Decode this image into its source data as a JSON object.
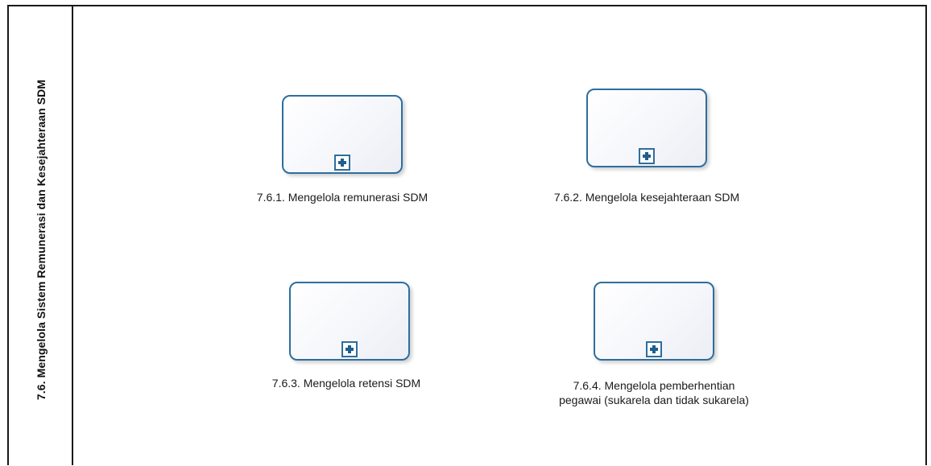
{
  "pool": {
    "title": "7.6. Mengelola Sistem Remunerasi dan Kesejahteraan SDM"
  },
  "tasks": [
    {
      "label": "7.6.1. Mengelola remunerasi SDM",
      "marker": "plus-icon"
    },
    {
      "label": "7.6.2. Mengelola kesejahteraan SDM",
      "marker": "plus-icon"
    },
    {
      "label": "7.6.3. Mengelola retensi SDM",
      "marker": "plus-icon"
    },
    {
      "label": "7.6.4. Mengelola pemberhentian pegawai (sukarela dan tidak sukarela)",
      "marker": "plus-icon"
    }
  ],
  "colors": {
    "task_border": "#2e6e9e",
    "pool_border": "#1a1a1a"
  }
}
